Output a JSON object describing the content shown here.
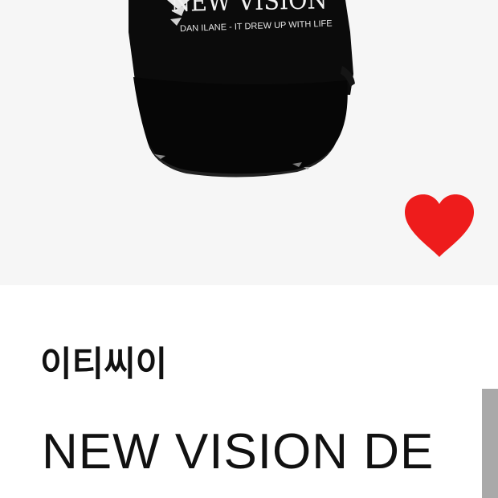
{
  "product": {
    "image_alt": "black cap",
    "cap_print_main": "NEW VISION",
    "cap_print_sub": "DAN ILANE - IT DREW UP WITH LIFE",
    "brand": "이티씨이",
    "name": "NEW VISION DE",
    "liked": true
  },
  "colors": {
    "like_heart": "#ee1c1c",
    "scrollbar": "#a9a9a9"
  },
  "icons": {
    "like": "heart-icon"
  }
}
